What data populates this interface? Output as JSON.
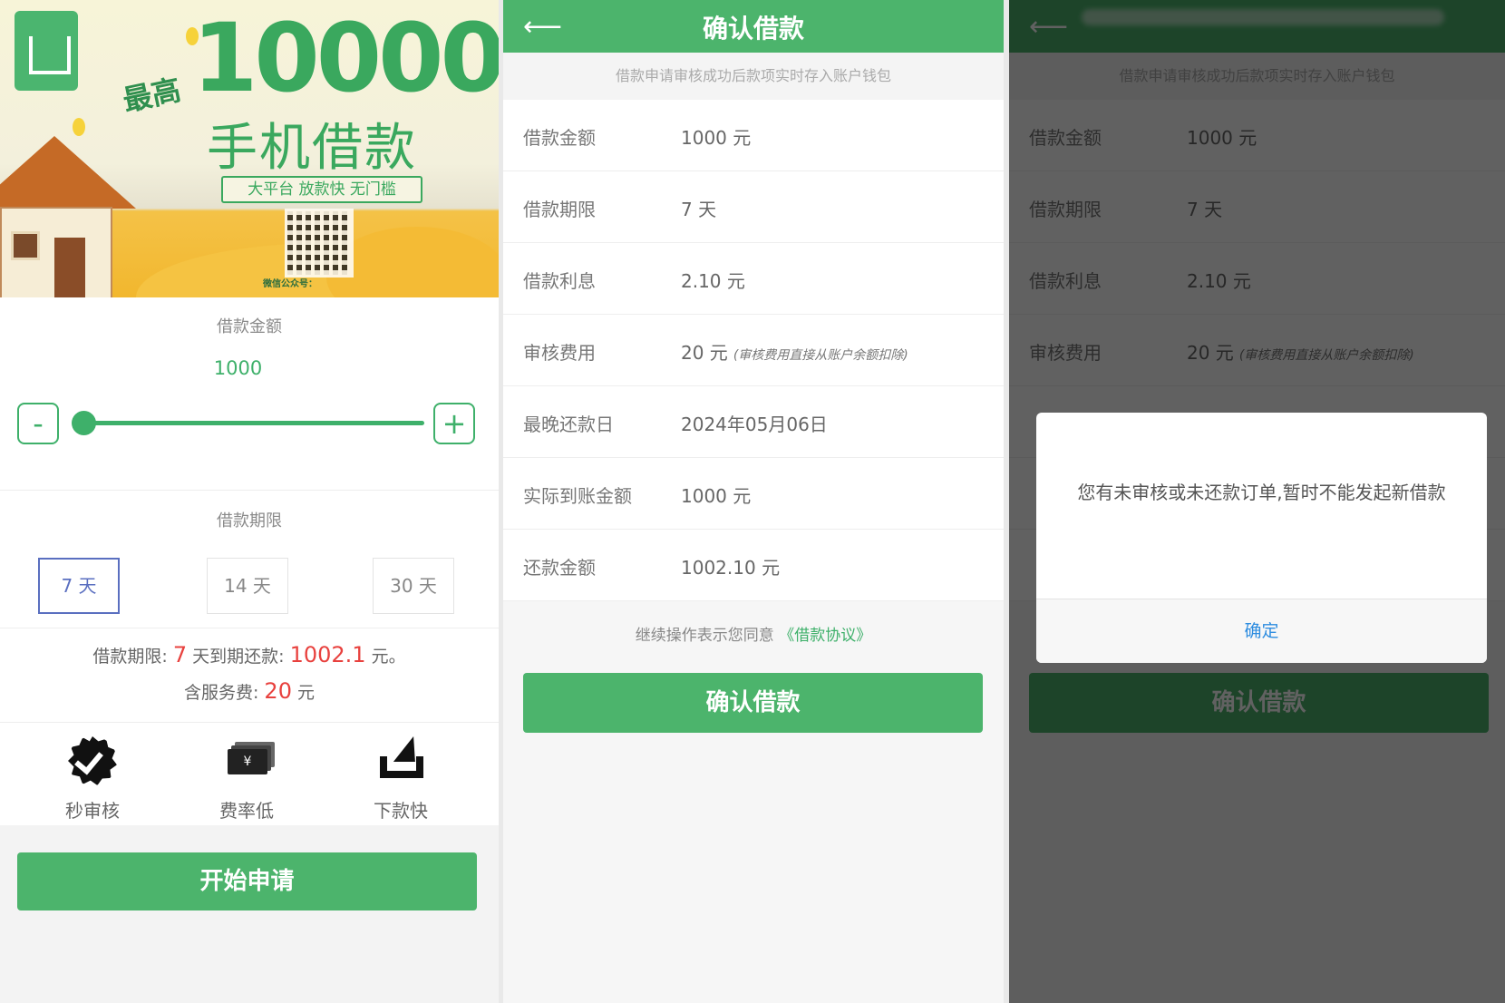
{
  "loan_form": {
    "banner": {
      "prefix": "最高",
      "amount": "10000",
      "title": "手机借款",
      "tagline": "大平台 放款快 无门槛",
      "account_note": "微信公众号："
    },
    "amount_label": "借款金额",
    "amount_value": "1000",
    "minus_label": "-",
    "plus_label": "+",
    "slider_fraction": 0.0,
    "term_label": "借款期限",
    "terms": [
      {
        "label": "7 天",
        "selected": true
      },
      {
        "label": "14 天",
        "selected": false
      },
      {
        "label": "30 天",
        "selected": false
      }
    ],
    "summary": {
      "prefix": "借款期限:",
      "days": "7",
      "middle": "天到期还款:",
      "repay": "1002.1",
      "unit": "元。",
      "fee_prefix": "含服务费:",
      "fee": "20",
      "fee_unit": "元"
    },
    "features": [
      {
        "label": "秒审核",
        "icon": "verified-icon"
      },
      {
        "label": "费率低",
        "icon": "money-icon"
      },
      {
        "label": "下款快",
        "icon": "lightning-icon"
      }
    ],
    "apply_button": "开始申请"
  },
  "confirm_page": {
    "title": "确认借款",
    "back_icon": "back-arrow-icon",
    "notice": "借款申请审核成功后款项实时存入账户钱包",
    "rows": [
      {
        "key": "借款金额",
        "value": "1000 元",
        "note": ""
      },
      {
        "key": "借款期限",
        "value": "7 天",
        "note": ""
      },
      {
        "key": "借款利息",
        "value": "2.10 元",
        "note": ""
      },
      {
        "key": "审核费用",
        "value": "20 元",
        "note": "(审核费用直接从账户余额扣除)"
      },
      {
        "key": "最晚还款日",
        "value": "2024年05月06日",
        "note": ""
      },
      {
        "key": "实际到账金额",
        "value": "1000 元",
        "note": ""
      },
      {
        "key": "还款金额",
        "value": "1002.10 元",
        "note": ""
      }
    ],
    "agree_text": "继续操作表示您同意",
    "agree_link": "《借款协议》",
    "confirm_button": "确认借款"
  },
  "dialog_page": {
    "dialog_message": "您有未审核或未还款订单,暂时不能发起新借款",
    "ok_button": "确定"
  },
  "colors": {
    "brand_green": "#4cb46c",
    "accent_red": "#e8413e",
    "selected_blue": "#5a6fc0",
    "link_blue": "#2e8de0"
  }
}
